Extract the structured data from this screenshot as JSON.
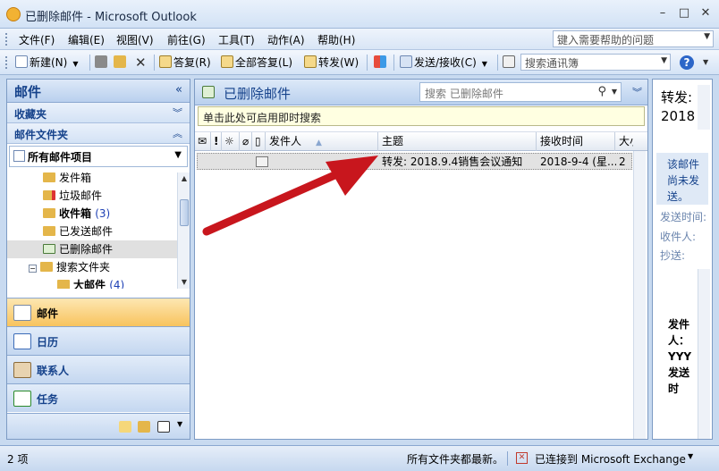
{
  "window": {
    "title": "已删除邮件 - Microsoft Outlook",
    "minimize": "–",
    "maximize": "□",
    "close": "✕"
  },
  "menu": {
    "items": [
      "文件(F)",
      "编辑(E)",
      "视图(V)",
      "前往(G)",
      "工具(T)",
      "动作(A)",
      "帮助(H)"
    ],
    "help_placeholder": "键入需要帮助的问题"
  },
  "toolbar": {
    "new": "新建(N)",
    "reply": "答复(R)",
    "reply_all": "全部答复(L)",
    "forward": "转发(W)",
    "send_receive": "发送/接收(C)",
    "search_contacts": "搜索通讯簿",
    "help": "?"
  },
  "nav": {
    "title": "邮件",
    "favorites": "收藏夹",
    "mail_folders": "邮件文件夹",
    "all_items": "所有邮件项目",
    "folders": [
      {
        "label": "发件箱",
        "count": "",
        "bold": false
      },
      {
        "label": "垃圾邮件",
        "count": "",
        "bold": false
      },
      {
        "label": "收件箱",
        "count": "(3)",
        "bold": true
      },
      {
        "label": "已发送邮件",
        "count": "",
        "bold": false
      },
      {
        "label": "已删除邮件",
        "count": "",
        "bold": false
      },
      {
        "label": "搜索文件夹",
        "count": "",
        "bold": false
      },
      {
        "label": "大邮件",
        "count": "(4)",
        "bold": true
      }
    ],
    "buttons": {
      "mail": "邮件",
      "calendar": "日历",
      "contacts": "联系人",
      "tasks": "任务"
    }
  },
  "list": {
    "folder_title": "已删除邮件",
    "search_placeholder": "搜索 已删除邮件",
    "instant_search_hint": "单击此处可启用即时搜索",
    "columns": {
      "sender": "发件人",
      "subject": "主题",
      "received": "接收时间",
      "size": "大小"
    },
    "rows": [
      {
        "sender": "",
        "subject": "转发: 2018.9.4销售会议通知",
        "received": "2018-9-4 (星...",
        "size": "2"
      }
    ]
  },
  "reading": {
    "subject_line1": "转发:",
    "subject_line2": "2018",
    "not_sent": "该邮件尚未发送。",
    "sent_time_label": "发送时间:",
    "to_label": "收件人:",
    "cc_label": "抄送:",
    "body": "发件人：YYY发送时"
  },
  "status": {
    "items": "2 项",
    "all_updated": "所有文件夹都最新。",
    "connection": "已连接到 Microsoft Exchange"
  },
  "colors": {
    "accent": "#15428b",
    "active_nav": "#f8c35d",
    "arrow": "#c8161d"
  }
}
